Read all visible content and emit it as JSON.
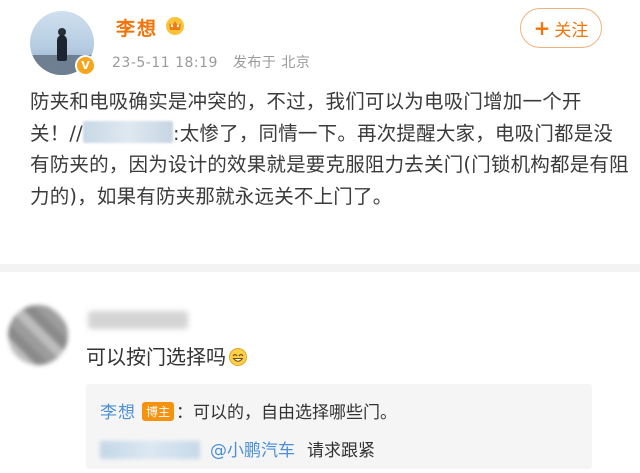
{
  "post": {
    "author": "李想",
    "date": "23-5-11 18:19",
    "location": "发布于 北京",
    "follow_label": "关注",
    "follow_plus": "+",
    "verified_mark": "V",
    "body_part1": "防夹和电吸确实是冲突的，不过，我们可以为电吸门增加一个开关！//",
    "body_part2": ":太惨了，同情一下。再次提醒大家，电吸门都是没有防夹的，因为设计的效果就是要克服阻力去关门(门锁机构都是有阻力的)，如果有防夹那就永远关不上门了。"
  },
  "comment": {
    "text": "可以按门选择吗",
    "reply": {
      "author": "李想",
      "badge": "博主",
      "text": "：可以的，自由选择哪些门。",
      "mention": "@小鹏汽车",
      "followup": "请求跟紧"
    }
  },
  "colors": {
    "brand_orange": "#f0740a",
    "link_blue": "#4c8fd6",
    "badge_orange": "#f7920f"
  },
  "icons": [
    "crown-icon",
    "verified-badge-icon",
    "smile-emoji-icon"
  ]
}
